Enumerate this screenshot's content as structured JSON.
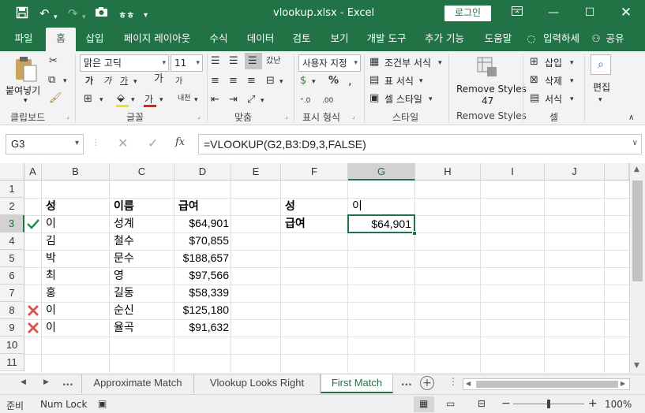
{
  "title": {
    "file": "vlookup.xlsx  -  Excel",
    "login": "로그인"
  },
  "tabs": [
    "파일",
    "홈",
    "삽입",
    "페이지 레이아웃",
    "수식",
    "데이터",
    "검토",
    "보기",
    "개발 도구",
    "추가 기능",
    "도움말",
    "입력하세",
    "공유"
  ],
  "ribbon": {
    "paste": "붙여넣기",
    "clipboard": "클립보드",
    "font_name": "맑은 고딕",
    "font_size": "11",
    "font": "글꼴",
    "align": "맞춤",
    "wrap": "갔난",
    "number_format": "사용자 지정",
    "number": "표시 형식",
    "cond_format": "조건부 서식",
    "table_format": "표 서식",
    "cell_style": "셀 스타일",
    "style": "스타일",
    "remove_styles": "Remove Styles",
    "remove_count": "47",
    "remove_group": "Remove Styles",
    "insert": "삽입",
    "delete": "삭제",
    "format": "서식",
    "cells": "셀",
    "edit": "편집",
    "font_btns": [
      "가",
      "가",
      "가"
    ],
    "font_grow": "가"
  },
  "namebox": "G3",
  "formula": "=VLOOKUP(G2,B3:D9,3,FALSE)",
  "columns": [
    "A",
    "B",
    "C",
    "D",
    "E",
    "F",
    "G",
    "H",
    "I",
    "J"
  ],
  "rows": [
    "1",
    "2",
    "3",
    "4",
    "5",
    "6",
    "7",
    "8",
    "9",
    "10",
    "11"
  ],
  "table": {
    "headers": [
      "성",
      "이름",
      "급여"
    ],
    "data": [
      [
        "이",
        "성계",
        "$64,901"
      ],
      [
        "김",
        "철수",
        "$70,855"
      ],
      [
        "박",
        "문수",
        "$188,657"
      ],
      [
        "최",
        "영",
        "$97,566"
      ],
      [
        "홍",
        "길동",
        "$58,339"
      ],
      [
        "이",
        "순신",
        "$125,180"
      ],
      [
        "이",
        "율곡",
        "$91,632"
      ]
    ],
    "marks": [
      "check",
      "",
      "",
      "",
      "",
      "cross",
      "cross"
    ]
  },
  "lookup": {
    "label1": "성",
    "value1": "이",
    "label2": "급여",
    "value2": "$64,901"
  },
  "sheets": [
    "Approximate Match",
    "Vlookup Looks Right",
    "First Match"
  ],
  "status": {
    "ready": "준비",
    "numlock": "Num Lock",
    "zoom": "100%"
  },
  "colors": {
    "accent": "#217346",
    "check": "#2e8b57",
    "cross": "#d9534f"
  }
}
